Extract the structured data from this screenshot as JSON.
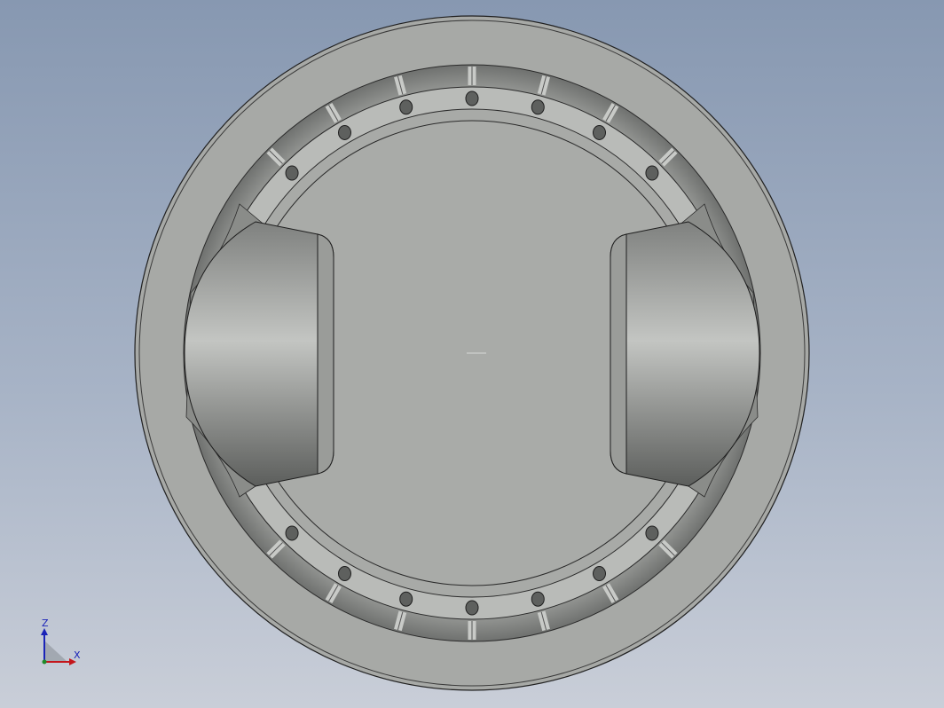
{
  "viewport": {
    "background_top": "#8798b1",
    "background_bottom": "#c9ced8"
  },
  "model": {
    "body_color": "#a8aaa7",
    "shadow_color": "#6d6f6d",
    "edge_color": "#1e1e1e",
    "hole_count_outer": 24,
    "hole_count_inner": 24
  },
  "triad": {
    "z_label": "Z",
    "x_label": "X",
    "z_color": "#1a23b8",
    "x_color": "#c4161c"
  }
}
